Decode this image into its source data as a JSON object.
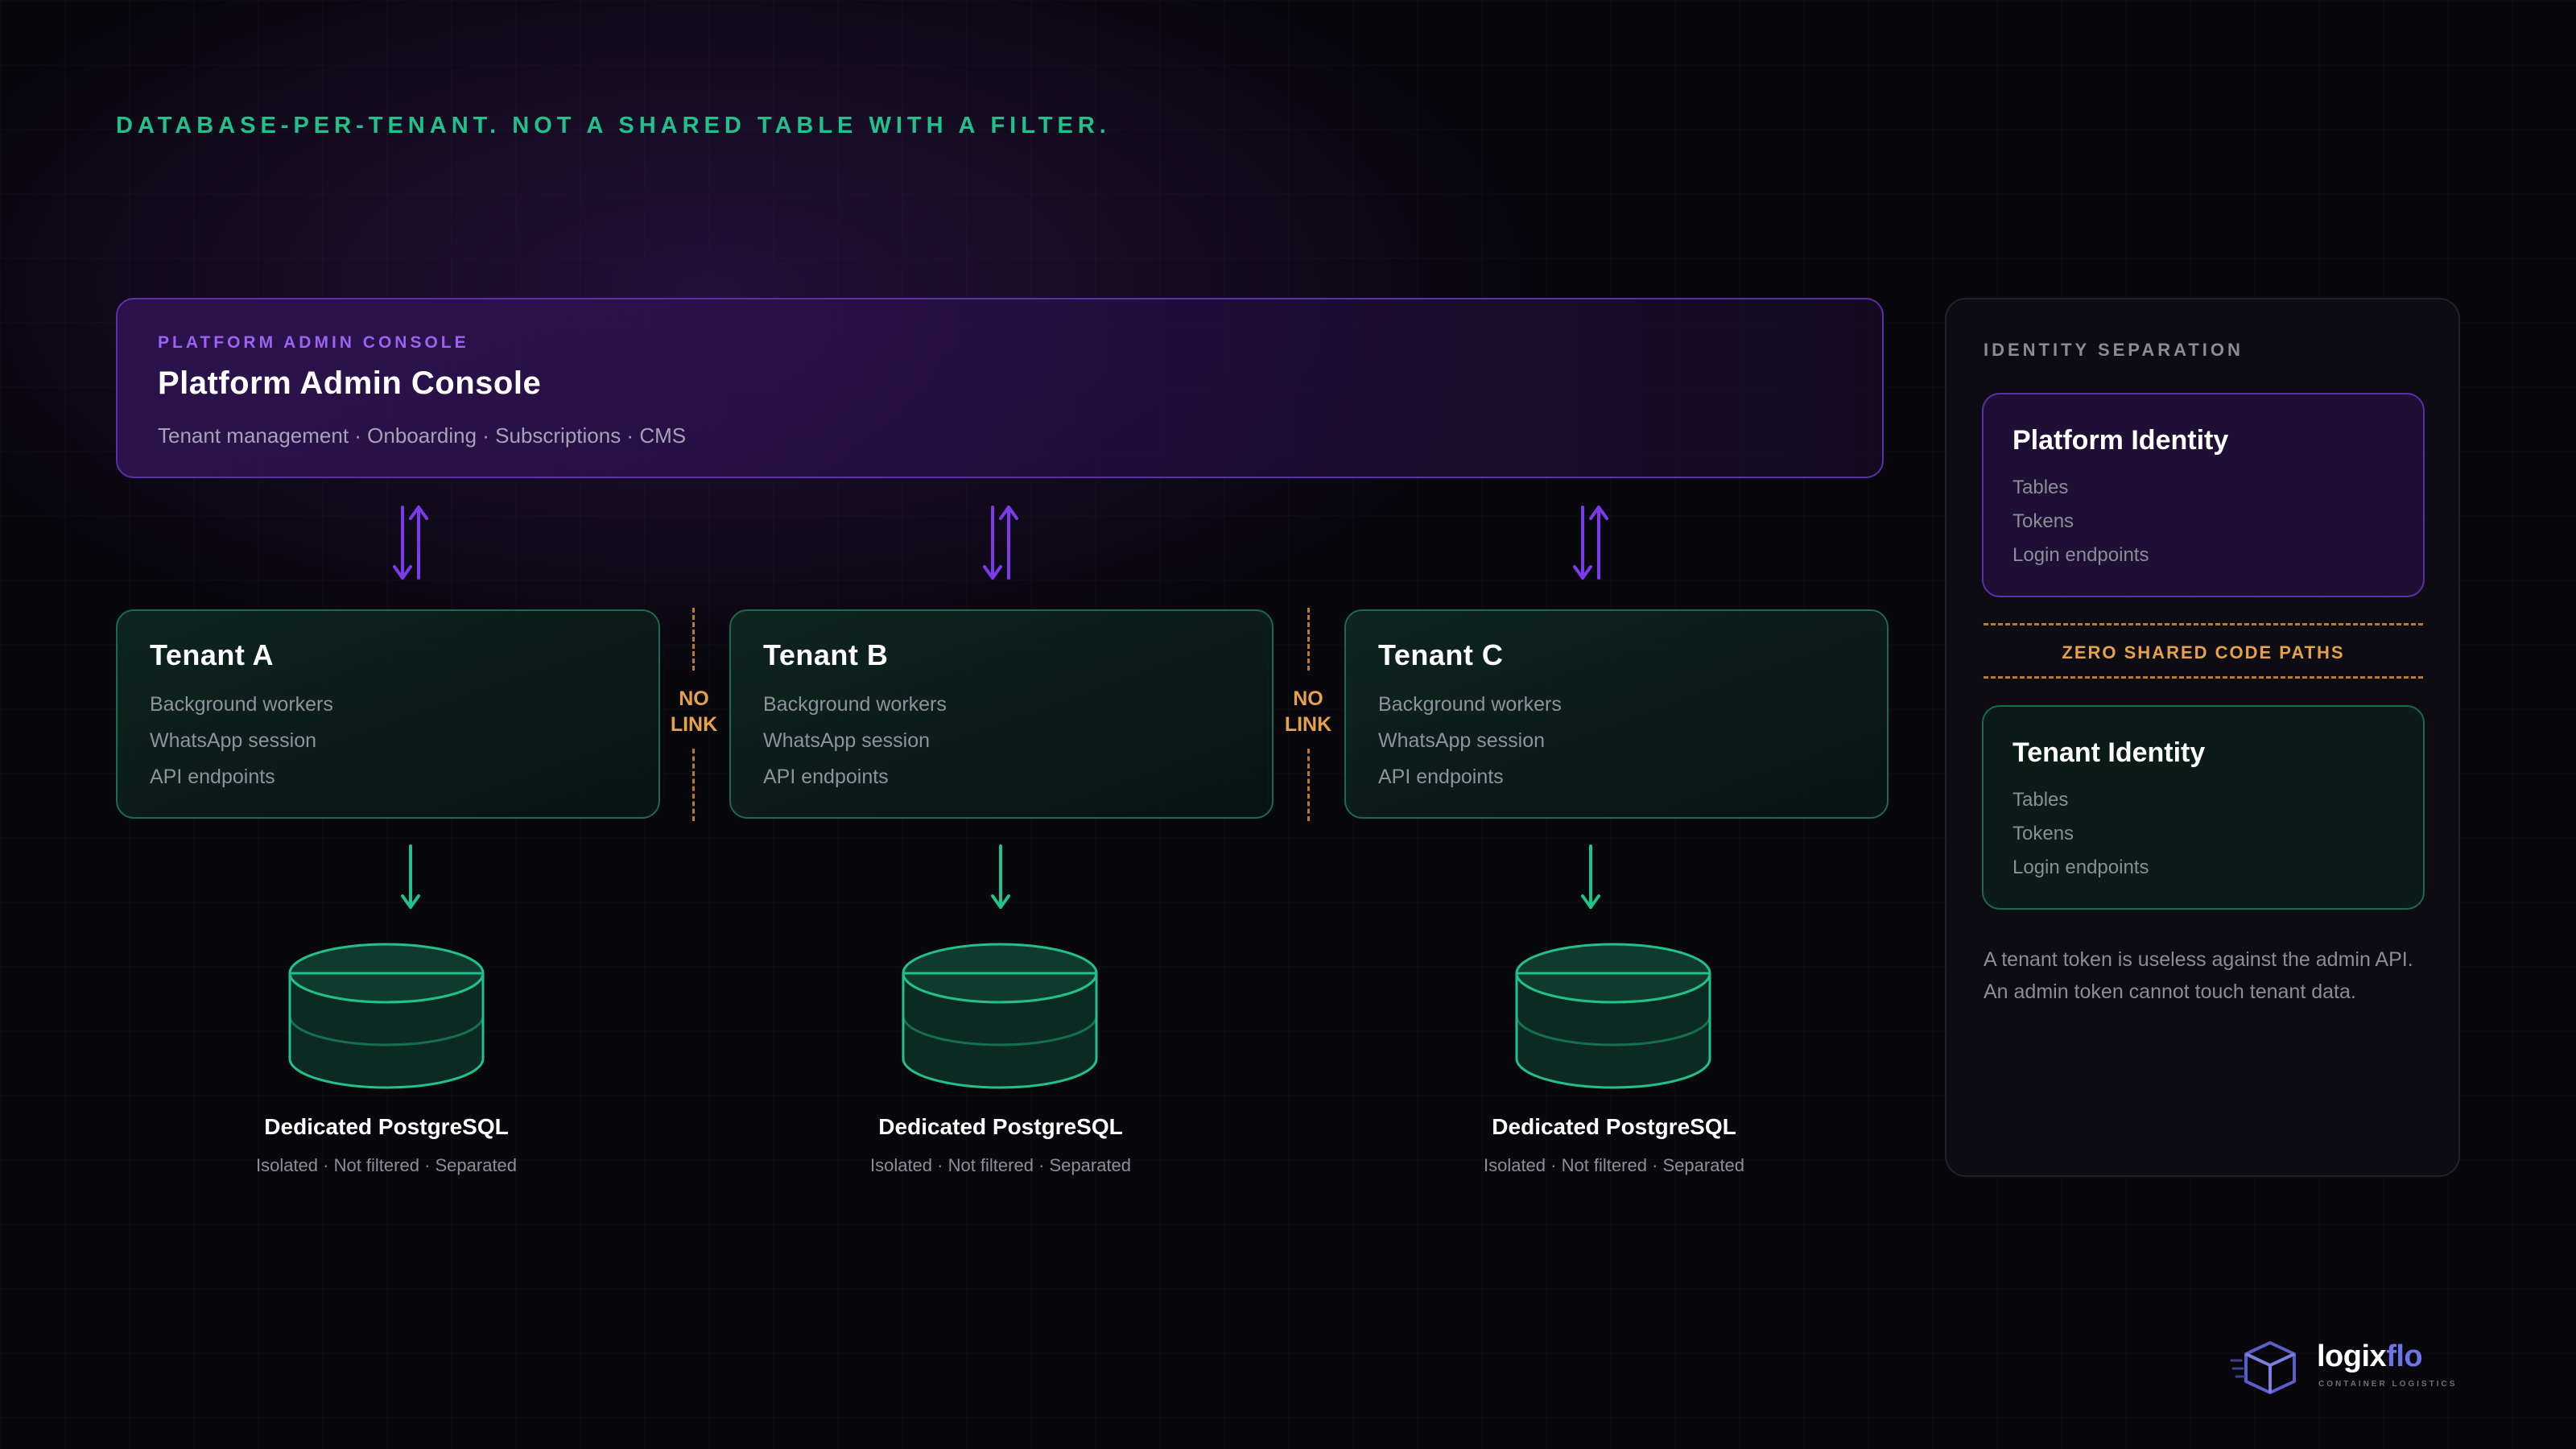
{
  "headline": "DATABASE-PER-TENANT. NOT A SHARED TABLE WITH A FILTER.",
  "admin_console": {
    "label": "PLATFORM ADMIN CONSOLE",
    "title": "Platform Admin Console",
    "subtitle": "Tenant management · Onboarding · Subscriptions · CMS"
  },
  "tenants": [
    {
      "title": "Tenant A",
      "features": [
        "Background workers",
        "WhatsApp session",
        "API endpoints"
      ]
    },
    {
      "title": "Tenant B",
      "features": [
        "Background workers",
        "WhatsApp session",
        "API endpoints"
      ]
    },
    {
      "title": "Tenant C",
      "features": [
        "Background workers",
        "WhatsApp session",
        "API endpoints"
      ]
    }
  ],
  "no_link": {
    "line1": "NO",
    "line2": "LINK"
  },
  "databases": [
    {
      "title": "Dedicated PostgreSQL",
      "subtitle": "Isolated · Not filtered · Separated"
    },
    {
      "title": "Dedicated PostgreSQL",
      "subtitle": "Isolated · Not filtered · Separated"
    },
    {
      "title": "Dedicated PostgreSQL",
      "subtitle": "Isolated · Not filtered · Separated"
    }
  ],
  "identity_panel": {
    "label": "IDENTITY SEPARATION",
    "platform": {
      "title": "Platform Identity",
      "items": [
        "Tables",
        "Tokens",
        "Login endpoints"
      ]
    },
    "divider": "ZERO SHARED CODE PATHS",
    "tenant": {
      "title": "Tenant Identity",
      "items": [
        "Tables",
        "Tokens",
        "Login endpoints"
      ]
    },
    "note": "A tenant token is useless against the admin API. An admin token cannot touch tenant data."
  },
  "brand": {
    "name_part1": "logix",
    "name_part2": "flo",
    "tagline": "CONTAINER LOGISTICS"
  },
  "colors": {
    "purple": "#7c3aed",
    "green": "#22c08a",
    "amber": "#e6a24a",
    "background": "#08070c"
  },
  "icons": [
    "bidirectional-arrow-icon",
    "down-arrow-icon",
    "database-cylinder-icon",
    "logo-cube-icon"
  ]
}
